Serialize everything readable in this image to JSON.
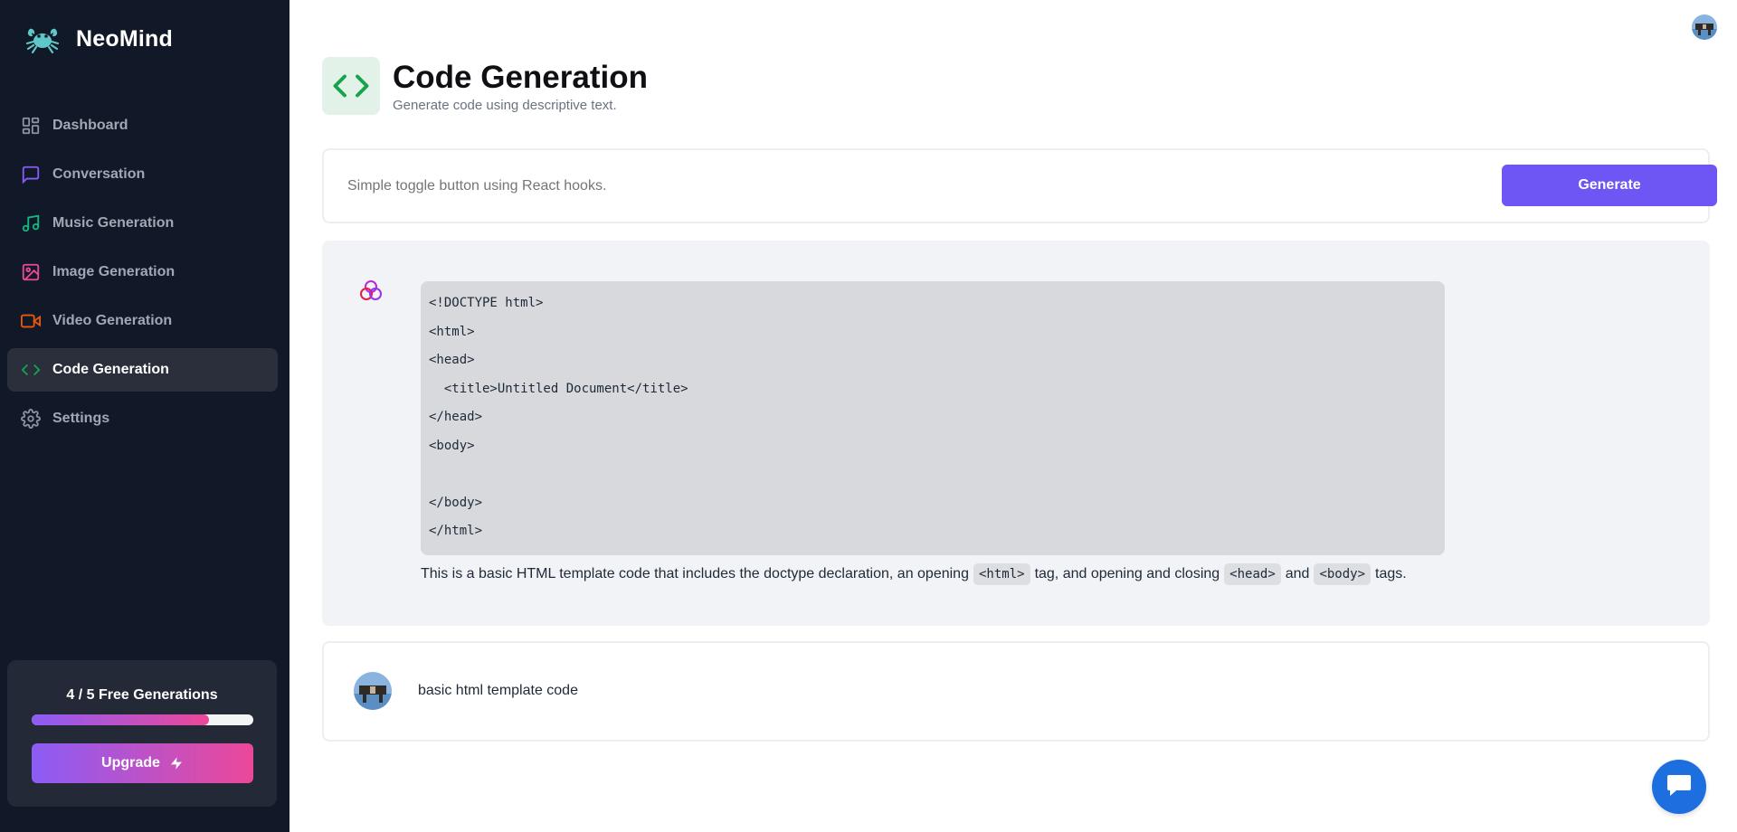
{
  "brand": {
    "name": "NeoMind"
  },
  "sidebar": {
    "items": [
      {
        "label": "Dashboard",
        "icon": "layout-dashboard-icon",
        "color": "#8b93a1",
        "active": false
      },
      {
        "label": "Conversation",
        "icon": "message-square-icon",
        "color": "#8b5cf6",
        "active": false
      },
      {
        "label": "Music Generation",
        "icon": "music-icon",
        "color": "#10b981",
        "active": false
      },
      {
        "label": "Image Generation",
        "icon": "image-icon",
        "color": "#ec4899",
        "active": false
      },
      {
        "label": "Video Generation",
        "icon": "video-icon",
        "color": "#ea580c",
        "active": false
      },
      {
        "label": "Code Generation",
        "icon": "code-icon",
        "color": "#16a34a",
        "active": true
      },
      {
        "label": "Settings",
        "icon": "settings-icon",
        "color": "#8b93a1",
        "active": false
      }
    ]
  },
  "usage": {
    "text": "4 / 5 Free Generations",
    "progress": 0.8,
    "upgrade_label": "Upgrade"
  },
  "header": {
    "title": "Code Generation",
    "subtitle": "Generate code using descriptive text."
  },
  "form": {
    "placeholder": "Simple toggle button using React hooks.",
    "button_label": "Generate"
  },
  "answer": {
    "code_lines": [
      "<!DOCTYPE html>",
      "<html>",
      "<head>",
      "  <title>Untitled Document</title>",
      "</head>",
      "<body>",
      "",
      "</body>",
      "</html>"
    ],
    "text_1": "This is a basic HTML template code that includes the doctype declaration, an opening",
    "chip_1": "<html>",
    "text_2": "tag, and opening and closing",
    "chip_2": "<head>",
    "text_3": "and",
    "chip_3": "<body>",
    "text_4": "tags."
  },
  "user_message": {
    "text": "basic html template code"
  },
  "colors": {
    "sidebar_bg": "#111827",
    "accent": "#6d56f3",
    "chat_bubble": "#1d6fe0",
    "code_green": "#16a34a"
  }
}
